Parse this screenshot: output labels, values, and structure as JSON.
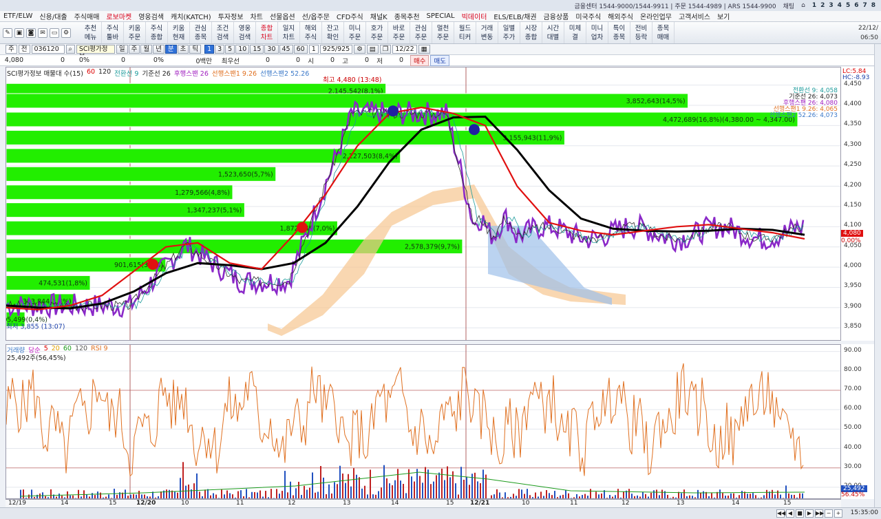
{
  "titlebar": {
    "center": "금융센터 1544-9000/1544-9911 | 주문 1544-4989 | ARS 1544-9900",
    "chat": "채팅",
    "pages": [
      "1",
      "2",
      "3",
      "4",
      "5",
      "6",
      "7",
      "8"
    ]
  },
  "menu": [
    {
      "label": "ETF/ELW",
      "hl": false
    },
    {
      "label": "신용/대출",
      "hl": false
    },
    {
      "label": "주식매매",
      "hl": false
    },
    {
      "label": "로보마켓",
      "hl": true
    },
    {
      "label": "영웅검색",
      "hl": false
    },
    {
      "label": "캐치(KATCH)",
      "hl": false
    },
    {
      "label": "투자정보",
      "hl": false
    },
    {
      "label": "차트",
      "hl": false
    },
    {
      "label": "선물옵션",
      "hl": false
    },
    {
      "label": "선/옵주문",
      "hl": false
    },
    {
      "label": "CFD주식",
      "hl": false
    },
    {
      "label": "채널K",
      "hl": false
    },
    {
      "label": "종목추천",
      "hl": false
    },
    {
      "label": "SPECIAL",
      "hl": false
    },
    {
      "label": "빅데이터",
      "hl": true
    },
    {
      "label": "ELS/ELB/채권",
      "hl": false
    },
    {
      "label": "금융상품",
      "hl": false
    },
    {
      "label": "미국주식",
      "hl": false
    },
    {
      "label": "해외주식",
      "hl": false
    },
    {
      "label": "온라인업무",
      "hl": false
    },
    {
      "label": "고객서비스",
      "hl": false
    },
    {
      "label": "보기",
      "hl": false
    }
  ],
  "toolbar": [
    {
      "label": "추천\n메뉴"
    },
    {
      "label": "주식\n툴바"
    },
    {
      "label": "키움\n주문"
    },
    {
      "label": "주식\n종합"
    },
    {
      "label": "키움\n현재"
    },
    {
      "label": "관심\n종목"
    },
    {
      "label": "조건\n검색"
    },
    {
      "label": "영웅\n검색"
    },
    {
      "label": "종합\n차트",
      "hl": true
    },
    {
      "label": "일지\n차트"
    },
    {
      "label": "해외\n주식"
    },
    {
      "label": "잔고\n확인"
    },
    {
      "label": "미니\n주문"
    },
    {
      "label": "호가\n주문"
    },
    {
      "label": "바로\n주문"
    },
    {
      "label": "관심\n주문"
    },
    {
      "label": "멀천\n주문"
    },
    {
      "label": "월드\n티커"
    },
    {
      "label": "거래\n변동"
    },
    {
      "label": "일별\n주가"
    },
    {
      "label": "시장\n종합"
    },
    {
      "label": "시간\n대별"
    },
    {
      "label": "미체\n결"
    },
    {
      "label": "미니\n업차"
    },
    {
      "label": "특이\n종목"
    },
    {
      "label": "전비\n등락"
    },
    {
      "label": "종목\n매매"
    }
  ],
  "topright": {
    "date": "22/12/",
    "time": "06:50"
  },
  "controls": {
    "tab": "주",
    "prefix": "전",
    "code": "036120",
    "name": "SCI평가정보",
    "periods": [
      "일",
      "주",
      "월",
      "년",
      "분",
      "초",
      "틱"
    ],
    "minutes": [
      "1",
      "3",
      "5",
      "10",
      "15",
      "30",
      "45",
      "60"
    ],
    "count": "1",
    "range": "925/925",
    "date": "12/22"
  },
  "info": {
    "price": "4,080",
    "change": "0",
    "change_pct": "0%",
    "volume": "0",
    "vol_pct": "0%",
    "amount": "0백만",
    "best_ask_label": "최우선",
    "v1": "0",
    "v2": "0",
    "label_si": "시",
    "si": "0",
    "label_go": "고",
    "go": "0",
    "label_jeo": "저",
    "jeo": "0",
    "buy": "매수",
    "sell": "매도"
  },
  "price_legend": {
    "name": "SCI평가정보 매물대 수(15)",
    "p1": "60",
    "p2": "120",
    "items": [
      {
        "t": "전환선 9",
        "c": "#1a9a9a"
      },
      {
        "t": "기준선 26",
        "c": "#222"
      },
      {
        "t": "후행스팬 26",
        "c": "#a020c0"
      },
      {
        "t": "선행스팬1 9.26",
        "c": "#e07020"
      },
      {
        "t": "선행스팬2 52.26",
        "c": "#3a78c8"
      }
    ]
  },
  "price_right_labels": [
    {
      "t": "전환선 9: 4,058",
      "c": "#1a9a9a"
    },
    {
      "t": "기준선 26: 4,073",
      "c": "#222"
    },
    {
      "t": "후행스팬 26: 4,080",
      "c": "#a020c0"
    },
    {
      "t": "선행스팬1 9.26: 4,065",
      "c": "#e07020"
    },
    {
      "t": "선행스팬2 52.26: 4,073",
      "c": "#3a78c8"
    }
  ],
  "lc_hc": {
    "lc": "LC:5.84",
    "hc": "HC:-8.93"
  },
  "annotations": {
    "high": "최고 4,480 (13:48)",
    "low": "최저 3,855 (13:07)"
  },
  "volume_profile": [
    {
      "label": "2,145,542(8,1%)",
      "price": 4437
    },
    {
      "label": "3,852,643(14,5%)",
      "price": 4412
    },
    {
      "label": "4,472,689(16,8%)(4,380.00 ~ 4,347.00)",
      "price": 4366
    },
    {
      "label": "3,155,943(11,9%)",
      "price": 4321
    },
    {
      "label": "2,227,503(8,4%)",
      "price": 4276
    },
    {
      "label": "1,523,650(5,7%)",
      "price": 4231
    },
    {
      "label": "1,279,566(4,8%)",
      "price": 4186
    },
    {
      "label": "1,347,237(5,1%)",
      "price": 4142
    },
    {
      "label": "1,872,348(7,0%)",
      "price": 4097
    },
    {
      "label": "2,578,379(9,7%)",
      "price": 4052
    },
    {
      "label": "901,615(3,4%)",
      "price": 4007
    },
    {
      "label": "474,531(1,8%)",
      "price": 3962
    },
    {
      "label": "383,844(1,4%)",
      "price": 3917
    },
    {
      "label": "105,499(0,4%)",
      "price": 3872
    }
  ],
  "price_axis": [
    "4,450",
    "4,400",
    "4,350",
    "4,300",
    "4,250",
    "4,200",
    "4,150",
    "4,100",
    "4,050",
    "4,000",
    "3,950",
    "3,900",
    "3,850"
  ],
  "price_axis_values": [
    4450,
    4400,
    4350,
    4300,
    4250,
    4200,
    4150,
    4100,
    4050,
    4000,
    3950,
    3900,
    3850
  ],
  "current_price": "4,080",
  "current_pct": "0.00%",
  "rsi_legend": {
    "vol": "거래량",
    "sum": "당순",
    "p5": "5",
    "p20": "20",
    "p60": "60",
    "p120": "120",
    "rsi": "RSI 9",
    "value": "25,492주(56,45%)"
  },
  "rsi_axis": [
    "90.00",
    "80.00",
    "70.00",
    "60.00",
    "50.00",
    "40.00",
    "30.00",
    "20.00"
  ],
  "rsi_axis_values": [
    90,
    80,
    70,
    60,
    50,
    40,
    30,
    20
  ],
  "rsi_badges": {
    "vol": "25,492",
    "pct": "56.45%"
  },
  "xaxis": [
    "12/19",
    "14",
    "15",
    "12/20",
    "10",
    "11",
    "12",
    "13",
    "14",
    "15",
    "12/21",
    "10",
    "11",
    "12",
    "13",
    "14",
    "15"
  ],
  "statusbar": {
    "time": "15:35:00"
  },
  "chart_data": [
    {
      "type": "line",
      "title": "SCI평가정보 매물대 수(15)",
      "ylim": [
        3830,
        4480
      ],
      "series": [
        {
          "name": "기준선 26",
          "values": [
            3905,
            3900,
            3898,
            3910,
            3940,
            3985,
            4010,
            4005,
            3995,
            4010,
            4060,
            4150,
            4260,
            4340,
            4370,
            4372,
            4290,
            4190,
            4120,
            4095,
            4090,
            4088,
            4090,
            4095,
            4092,
            4080
          ]
        },
        {
          "name": "전환선 9",
          "values": [
            3900,
            3895,
            3905,
            3930,
            3990,
            4050,
            4060,
            4010,
            3995,
            4080,
            4180,
            4300,
            4380,
            4395,
            4380,
            4350,
            4200,
            4110,
            4090,
            4080,
            4090,
            4100,
            4105,
            4095,
            4085,
            4070
          ]
        }
      ]
    },
    {
      "type": "line",
      "title": "RSI 9",
      "ylim": [
        15,
        92
      ],
      "series": [
        {
          "name": "RSI 9",
          "values": [
            70,
            45,
            60,
            55,
            48,
            62,
            70,
            40,
            58,
            52,
            80,
            68,
            35,
            55,
            60,
            72,
            48,
            30,
            58,
            65,
            50,
            45,
            60,
            70,
            35,
            55
          ]
        }
      ]
    }
  ]
}
